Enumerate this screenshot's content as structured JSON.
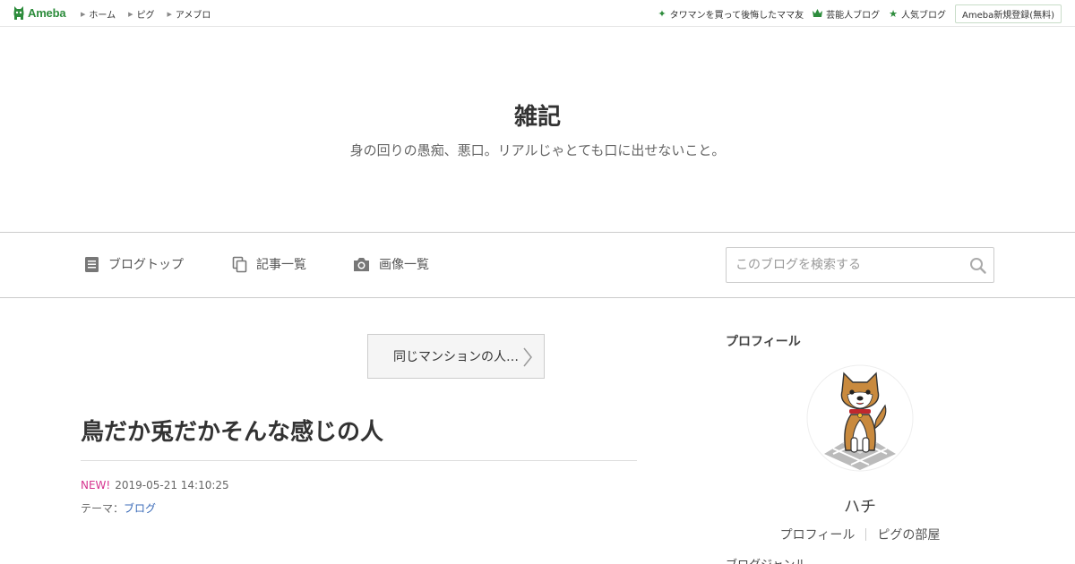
{
  "topbar": {
    "logo_text": "Ameba",
    "nav": [
      {
        "label": "ホーム"
      },
      {
        "label": "ピグ"
      },
      {
        "label": "アメブロ"
      }
    ],
    "right_links": [
      {
        "label": "タワマンを買って後悔したママ友",
        "icon": "sparkle-icon"
      },
      {
        "label": "芸能人ブログ",
        "icon": "crown-icon"
      },
      {
        "label": "人気ブログ",
        "icon": "star-icon"
      }
    ],
    "register_label": "Ameba新規登録(無料)"
  },
  "header": {
    "title": "雑記",
    "description": "身の回りの愚痴、悪口。リアルじゃとても口に出せないこと。"
  },
  "nav": {
    "blog_top": "ブログトップ",
    "article_list": "記事一覧",
    "image_list": "画像一覧",
    "search_placeholder": "このブログを検索する"
  },
  "main": {
    "prev_article_label": "同じマンションの人…",
    "article_title": "鳥だか兎だかそんな感じの人",
    "new_badge": "NEW!",
    "datetime": "2019-05-21 14:10:25",
    "theme_label": "テーマ：",
    "theme_link": "ブログ"
  },
  "sidebar": {
    "heading": "プロフィール",
    "name": "ハチ",
    "links": [
      "プロフィール",
      "ピグの部屋"
    ],
    "more_label": "ブログジャンル"
  },
  "colors": {
    "brand_green": "#2d8c3c",
    "new_pink": "#d6338f",
    "link_blue": "#3b6bb8"
  }
}
